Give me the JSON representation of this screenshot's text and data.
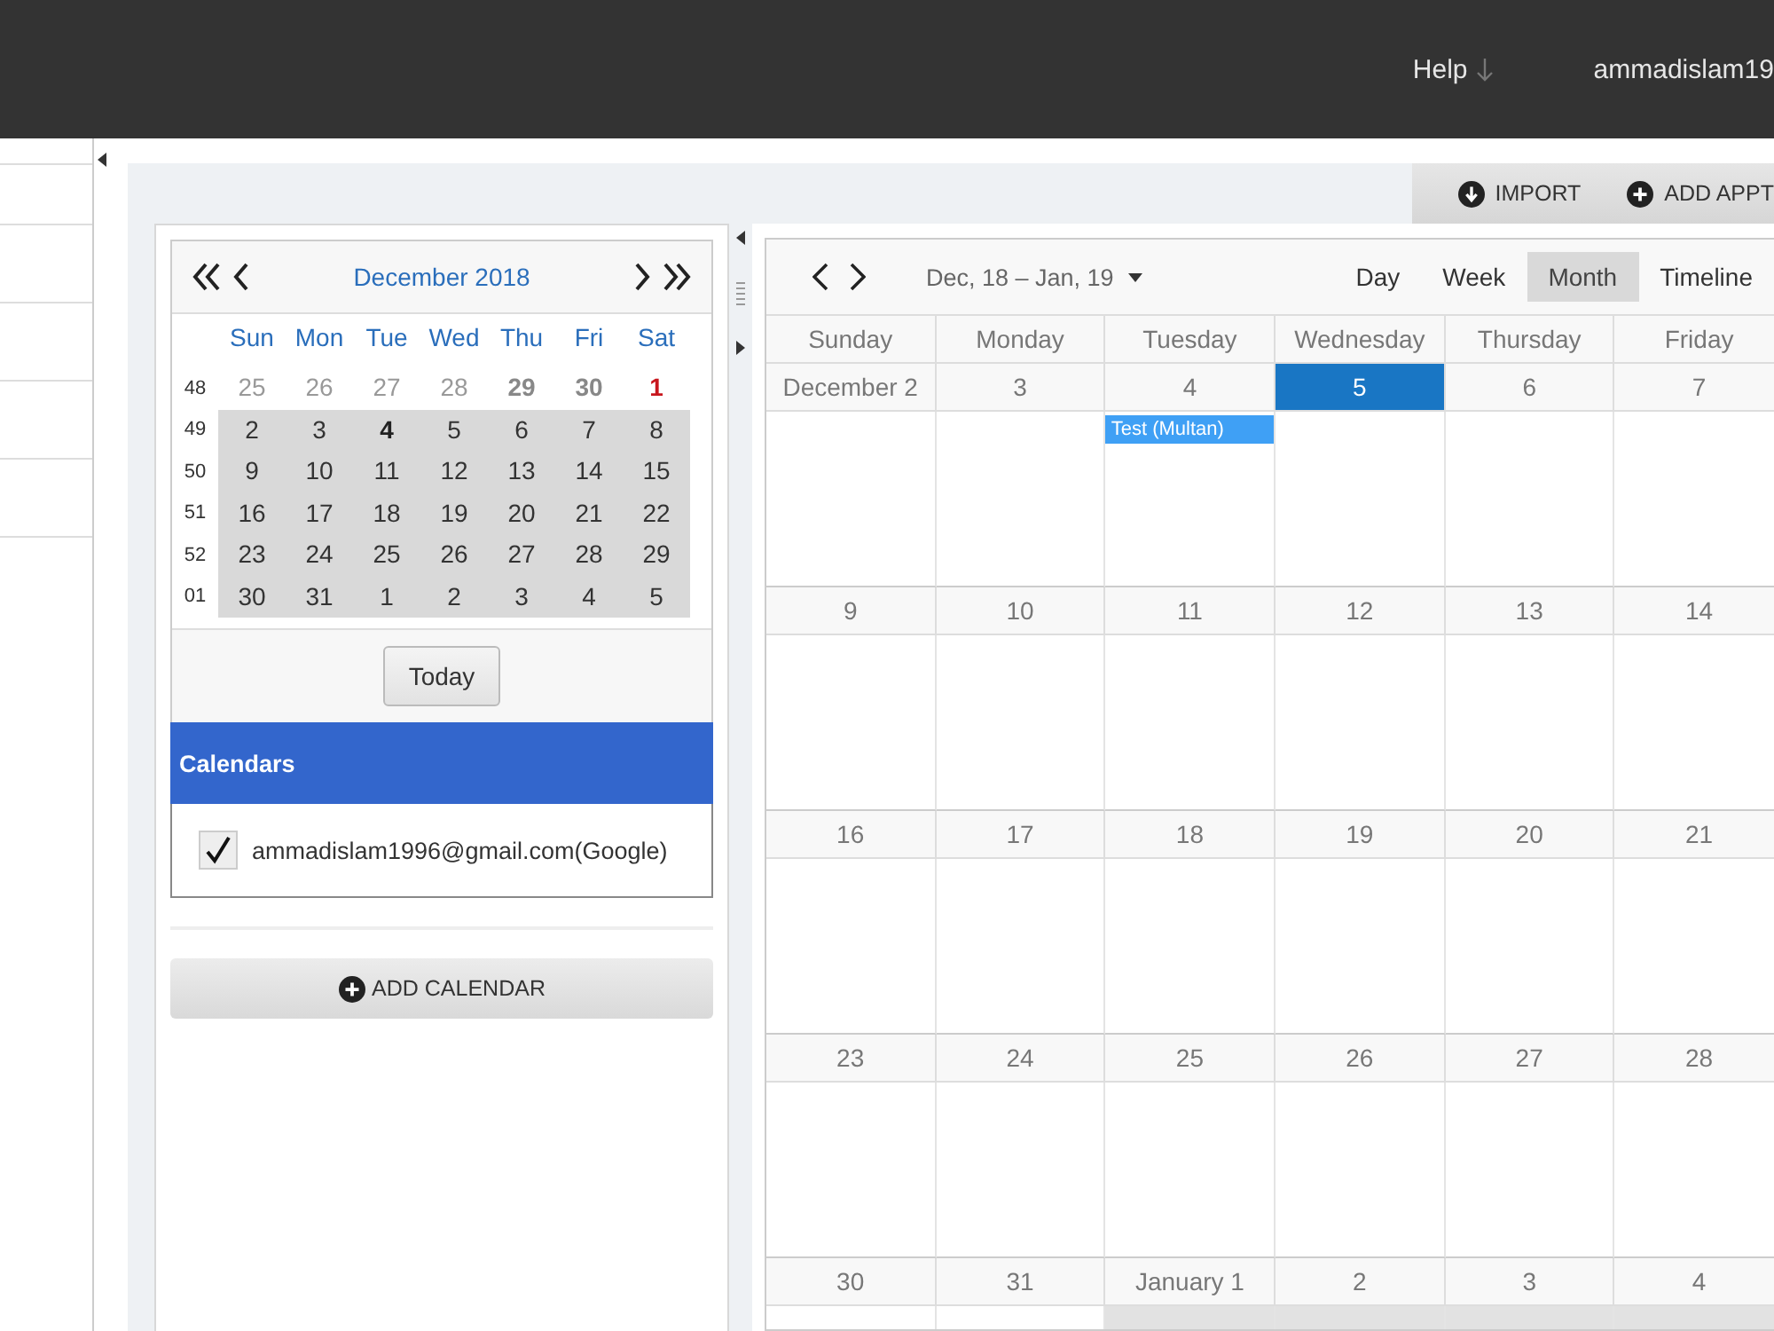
{
  "top_bar": {
    "help": "Help",
    "user": "ammadislam19"
  },
  "toolbar": {
    "buttons": [
      {
        "label": "IMPORT",
        "kind": "import"
      },
      {
        "label": "ADD APPT",
        "kind": "add"
      }
    ]
  },
  "mini_calendar": {
    "title": "December 2018",
    "weekdays": [
      "Sun",
      "Mon",
      "Tue",
      "Wed",
      "Thu",
      "Fri",
      "Sat"
    ],
    "weeks": [
      {
        "number": "48",
        "in_range": false,
        "days": [
          {
            "label": "25",
            "kind": "muted"
          },
          {
            "label": "26",
            "kind": "muted"
          },
          {
            "label": "27",
            "kind": "muted"
          },
          {
            "label": "28",
            "kind": "muted"
          },
          {
            "label": "29",
            "kind": "muted_bold"
          },
          {
            "label": "30",
            "kind": "muted_bold"
          },
          {
            "label": "1",
            "kind": "holiday"
          }
        ]
      },
      {
        "number": "49",
        "in_range": true,
        "days": [
          {
            "label": "2",
            "kind": "normal"
          },
          {
            "label": "3",
            "kind": "normal"
          },
          {
            "label": "4",
            "kind": "bold"
          },
          {
            "label": "5",
            "kind": "normal"
          },
          {
            "label": "6",
            "kind": "normal"
          },
          {
            "label": "7",
            "kind": "normal"
          },
          {
            "label": "8",
            "kind": "normal"
          }
        ]
      },
      {
        "number": "50",
        "in_range": true,
        "days": [
          {
            "label": "9",
            "kind": "normal"
          },
          {
            "label": "10",
            "kind": "normal"
          },
          {
            "label": "11",
            "kind": "normal"
          },
          {
            "label": "12",
            "kind": "normal"
          },
          {
            "label": "13",
            "kind": "normal"
          },
          {
            "label": "14",
            "kind": "normal"
          },
          {
            "label": "15",
            "kind": "normal"
          }
        ]
      },
      {
        "number": "51",
        "in_range": true,
        "days": [
          {
            "label": "16",
            "kind": "normal"
          },
          {
            "label": "17",
            "kind": "normal"
          },
          {
            "label": "18",
            "kind": "normal"
          },
          {
            "label": "19",
            "kind": "normal"
          },
          {
            "label": "20",
            "kind": "normal"
          },
          {
            "label": "21",
            "kind": "normal"
          },
          {
            "label": "22",
            "kind": "normal"
          }
        ]
      },
      {
        "number": "52",
        "in_range": true,
        "days": [
          {
            "label": "23",
            "kind": "normal"
          },
          {
            "label": "24",
            "kind": "normal"
          },
          {
            "label": "25",
            "kind": "normal"
          },
          {
            "label": "26",
            "kind": "normal"
          },
          {
            "label": "27",
            "kind": "normal"
          },
          {
            "label": "28",
            "kind": "normal"
          },
          {
            "label": "29",
            "kind": "normal"
          }
        ]
      },
      {
        "number": "01",
        "in_range": true,
        "days": [
          {
            "label": "30",
            "kind": "normal"
          },
          {
            "label": "31",
            "kind": "normal"
          },
          {
            "label": "1",
            "kind": "normal"
          },
          {
            "label": "2",
            "kind": "normal"
          },
          {
            "label": "3",
            "kind": "normal"
          },
          {
            "label": "4",
            "kind": "normal"
          },
          {
            "label": "5",
            "kind": "normal"
          }
        ]
      }
    ]
  },
  "today_button": "Today",
  "calendars": {
    "title": "Calendars",
    "items": [
      {
        "label": "ammadislam1996@gmail.com(Google)",
        "checked": true
      }
    ]
  },
  "add_calendar": "ADD CALENDAR",
  "scheduler": {
    "range": "Dec, 18 – Jan, 19",
    "views": [
      {
        "label": "Day",
        "selected": false
      },
      {
        "label": "Week",
        "selected": false
      },
      {
        "label": "Month",
        "selected": true
      },
      {
        "label": "Timeline",
        "selected": false
      }
    ],
    "day_headers": [
      "Sunday",
      "Monday",
      "Tuesday",
      "Wednesday",
      "Thursday",
      "Friday"
    ],
    "weeks": [
      {
        "dates": [
          {
            "label": "December 2",
            "selected": false,
            "other_month": false
          },
          {
            "label": "3",
            "selected": false,
            "other_month": false
          },
          {
            "label": "4",
            "selected": false,
            "other_month": false,
            "events": [
              "Test (Multan)"
            ]
          },
          {
            "label": "5",
            "selected": true,
            "other_month": false
          },
          {
            "label": "6",
            "selected": false,
            "other_month": false
          },
          {
            "label": "7",
            "selected": false,
            "other_month": false
          }
        ]
      },
      {
        "dates": [
          {
            "label": "9",
            "selected": false,
            "other_month": false
          },
          {
            "label": "10",
            "selected": false,
            "other_month": false
          },
          {
            "label": "11",
            "selected": false,
            "other_month": false
          },
          {
            "label": "12",
            "selected": false,
            "other_month": false
          },
          {
            "label": "13",
            "selected": false,
            "other_month": false
          },
          {
            "label": "14",
            "selected": false,
            "other_month": false
          }
        ]
      },
      {
        "dates": [
          {
            "label": "16",
            "selected": false,
            "other_month": false
          },
          {
            "label": "17",
            "selected": false,
            "other_month": false
          },
          {
            "label": "18",
            "selected": false,
            "other_month": false
          },
          {
            "label": "19",
            "selected": false,
            "other_month": false
          },
          {
            "label": "20",
            "selected": false,
            "other_month": false
          },
          {
            "label": "21",
            "selected": false,
            "other_month": false
          }
        ]
      },
      {
        "dates": [
          {
            "label": "23",
            "selected": false,
            "other_month": false
          },
          {
            "label": "24",
            "selected": false,
            "other_month": false
          },
          {
            "label": "25",
            "selected": false,
            "other_month": false
          },
          {
            "label": "26",
            "selected": false,
            "other_month": false
          },
          {
            "label": "27",
            "selected": false,
            "other_month": false
          },
          {
            "label": "28",
            "selected": false,
            "other_month": false
          }
        ]
      },
      {
        "dates": [
          {
            "label": "30",
            "selected": false,
            "other_month": false
          },
          {
            "label": "31",
            "selected": false,
            "other_month": false
          },
          {
            "label": "January 1",
            "selected": false,
            "other_month": true
          },
          {
            "label": "2",
            "selected": false,
            "other_month": true
          },
          {
            "label": "3",
            "selected": false,
            "other_month": true
          },
          {
            "label": "4",
            "selected": false,
            "other_month": true
          }
        ]
      }
    ]
  }
}
